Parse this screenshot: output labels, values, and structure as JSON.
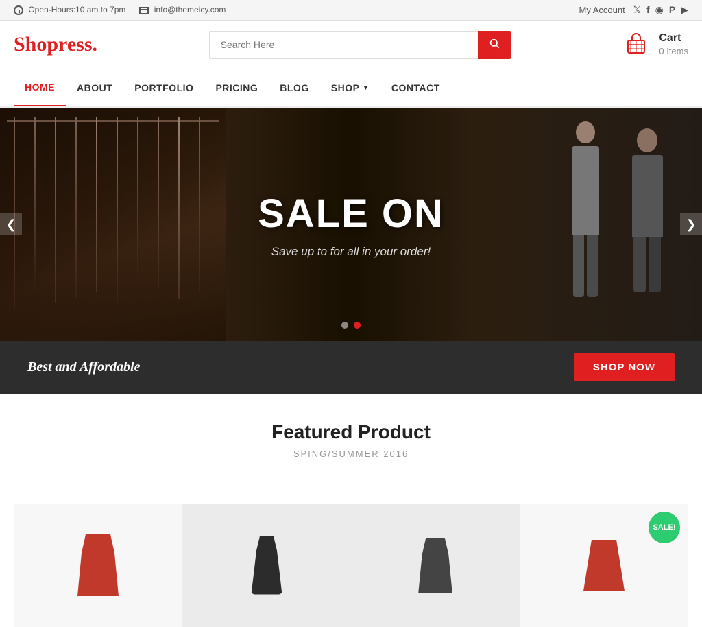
{
  "topbar": {
    "hours_icon": "clock",
    "hours_text": "Open-Hours:10 am to 7pm",
    "email_icon": "email",
    "email_text": "info@themeicy.com",
    "my_account": "My Account",
    "social": [
      "twitter",
      "facebook",
      "instagram",
      "pinterest",
      "youtube"
    ]
  },
  "header": {
    "logo": "Shopress",
    "logo_dot": ".",
    "search_placeholder": "Search Here",
    "search_button_icon": "search",
    "cart_label": "Cart",
    "cart_count": "0 Items"
  },
  "nav": {
    "items": [
      {
        "label": "HOME",
        "active": true
      },
      {
        "label": "ABOUT",
        "active": false
      },
      {
        "label": "PORTFOLIO",
        "active": false
      },
      {
        "label": "PRICING",
        "active": false
      },
      {
        "label": "BLOG",
        "active": false
      },
      {
        "label": "SHOP",
        "active": false,
        "has_dropdown": true
      },
      {
        "label": "CONTACT",
        "active": false
      }
    ]
  },
  "hero": {
    "title": "SALE ON",
    "subtitle": "Save up to for all in your order!",
    "dots": [
      false,
      true
    ],
    "prev_arrow": "❮",
    "next_arrow": "❯"
  },
  "banner": {
    "text": "Best and Affordable",
    "button_label": "Shop Now"
  },
  "featured": {
    "title": "Featured Product",
    "subtitle": "SPING/SUMMER 2016"
  },
  "products": [
    {
      "sale": false
    },
    {
      "sale": false
    },
    {
      "sale": false
    },
    {
      "sale": true,
      "sale_label": "SALE!"
    }
  ]
}
